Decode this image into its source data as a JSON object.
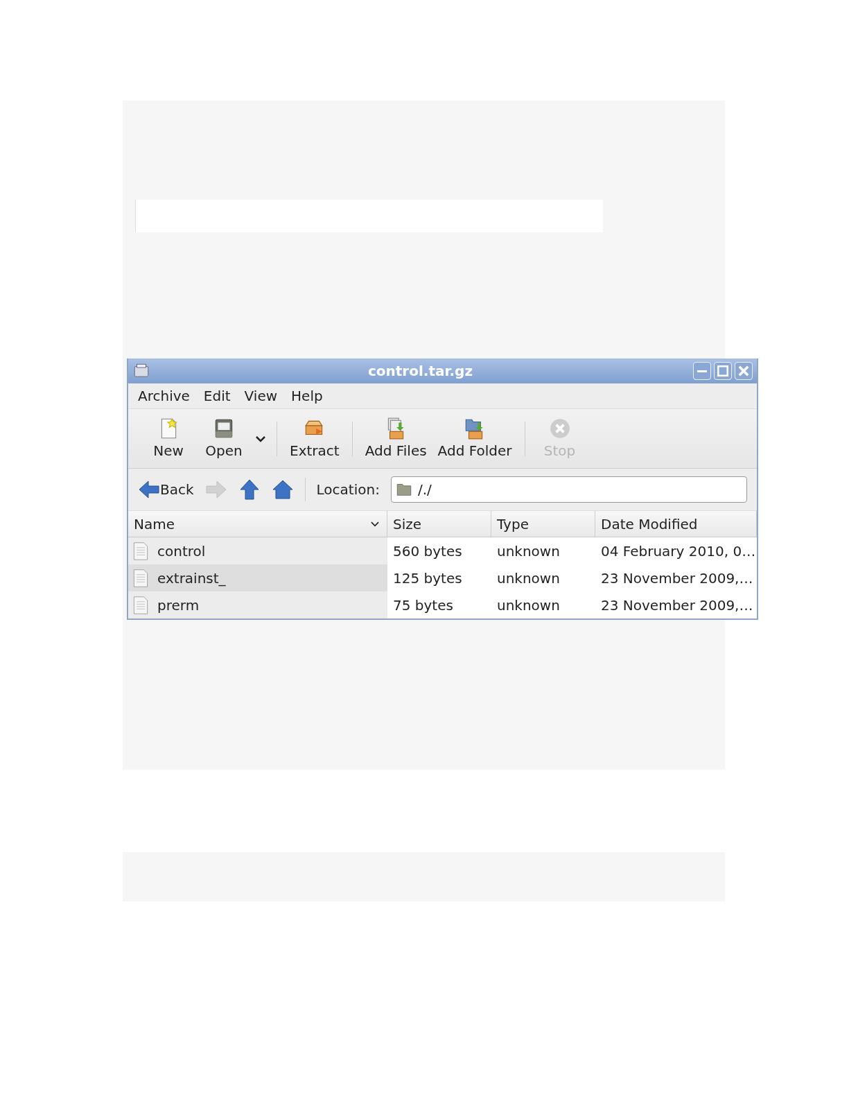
{
  "window": {
    "title": "control.tar.gz"
  },
  "menu": [
    "Archive",
    "Edit",
    "View",
    "Help"
  ],
  "toolbar": [
    {
      "kind": "new",
      "label": "New",
      "disabled": false
    },
    {
      "kind": "open",
      "label": "Open",
      "disabled": false
    },
    {
      "kind": "dropdown"
    },
    {
      "kind": "separator"
    },
    {
      "kind": "extract",
      "label": "Extract",
      "disabled": false
    },
    {
      "kind": "separator"
    },
    {
      "kind": "add-files",
      "label": "Add Files",
      "disabled": false
    },
    {
      "kind": "add-folder",
      "label": "Add Folder",
      "disabled": false
    },
    {
      "kind": "separator"
    },
    {
      "kind": "stop",
      "label": "Stop",
      "disabled": true
    }
  ],
  "nav": [
    {
      "kind": "back",
      "label": "Back",
      "disabled": false
    },
    {
      "kind": "forward",
      "disabled": true
    },
    {
      "kind": "up",
      "disabled": false
    },
    {
      "kind": "home",
      "disabled": false
    }
  ],
  "location": {
    "label": "Location:",
    "value": "/./"
  },
  "table": {
    "columns": [
      {
        "label": "Name",
        "sorted": true
      },
      {
        "label": "Size",
        "sorted": false
      },
      {
        "label": "Type",
        "sorted": false
      },
      {
        "label": "Date Modified",
        "sorted": false
      }
    ],
    "rows": [
      [
        "control",
        "560 bytes",
        "unknown",
        "04 February 2010, 0…"
      ],
      [
        "extrainst_",
        "125 bytes",
        "unknown",
        "23 November 2009,…"
      ],
      [
        "prerm",
        "75 bytes",
        "unknown",
        "23 November 2009,…"
      ]
    ]
  }
}
